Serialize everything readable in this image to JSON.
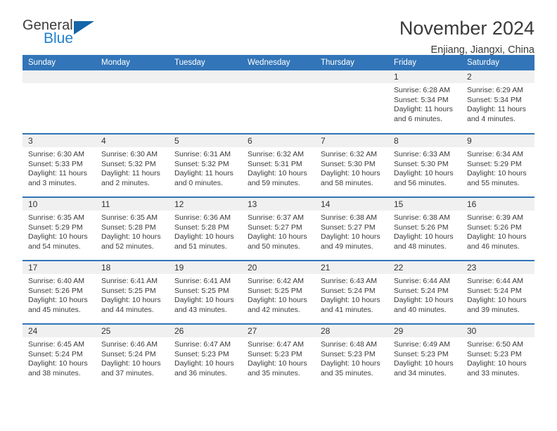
{
  "logo": {
    "word_general": "General",
    "word_blue": "Blue",
    "triangle_color": "#1565a8",
    "blue_color": "#1f7fd0"
  },
  "header": {
    "month_title": "November 2024",
    "location": "Enjiang, Jiangxi, China"
  },
  "theme": {
    "header_blue": "#3275b8",
    "daynum_band": "#f0f0f0",
    "text": "#3a3a3a"
  },
  "weekdays": [
    "Sunday",
    "Monday",
    "Tuesday",
    "Wednesday",
    "Thursday",
    "Friday",
    "Saturday"
  ],
  "weeks": [
    [
      {
        "day": ""
      },
      {
        "day": ""
      },
      {
        "day": ""
      },
      {
        "day": ""
      },
      {
        "day": ""
      },
      {
        "day": "1",
        "sunrise": "Sunrise: 6:28 AM",
        "sunset": "Sunset: 5:34 PM",
        "daylight": "Daylight: 11 hours and 6 minutes."
      },
      {
        "day": "2",
        "sunrise": "Sunrise: 6:29 AM",
        "sunset": "Sunset: 5:34 PM",
        "daylight": "Daylight: 11 hours and 4 minutes."
      }
    ],
    [
      {
        "day": "3",
        "sunrise": "Sunrise: 6:30 AM",
        "sunset": "Sunset: 5:33 PM",
        "daylight": "Daylight: 11 hours and 3 minutes."
      },
      {
        "day": "4",
        "sunrise": "Sunrise: 6:30 AM",
        "sunset": "Sunset: 5:32 PM",
        "daylight": "Daylight: 11 hours and 2 minutes."
      },
      {
        "day": "5",
        "sunrise": "Sunrise: 6:31 AM",
        "sunset": "Sunset: 5:32 PM",
        "daylight": "Daylight: 11 hours and 0 minutes."
      },
      {
        "day": "6",
        "sunrise": "Sunrise: 6:32 AM",
        "sunset": "Sunset: 5:31 PM",
        "daylight": "Daylight: 10 hours and 59 minutes."
      },
      {
        "day": "7",
        "sunrise": "Sunrise: 6:32 AM",
        "sunset": "Sunset: 5:30 PM",
        "daylight": "Daylight: 10 hours and 58 minutes."
      },
      {
        "day": "8",
        "sunrise": "Sunrise: 6:33 AM",
        "sunset": "Sunset: 5:30 PM",
        "daylight": "Daylight: 10 hours and 56 minutes."
      },
      {
        "day": "9",
        "sunrise": "Sunrise: 6:34 AM",
        "sunset": "Sunset: 5:29 PM",
        "daylight": "Daylight: 10 hours and 55 minutes."
      }
    ],
    [
      {
        "day": "10",
        "sunrise": "Sunrise: 6:35 AM",
        "sunset": "Sunset: 5:29 PM",
        "daylight": "Daylight: 10 hours and 54 minutes."
      },
      {
        "day": "11",
        "sunrise": "Sunrise: 6:35 AM",
        "sunset": "Sunset: 5:28 PM",
        "daylight": "Daylight: 10 hours and 52 minutes."
      },
      {
        "day": "12",
        "sunrise": "Sunrise: 6:36 AM",
        "sunset": "Sunset: 5:28 PM",
        "daylight": "Daylight: 10 hours and 51 minutes."
      },
      {
        "day": "13",
        "sunrise": "Sunrise: 6:37 AM",
        "sunset": "Sunset: 5:27 PM",
        "daylight": "Daylight: 10 hours and 50 minutes."
      },
      {
        "day": "14",
        "sunrise": "Sunrise: 6:38 AM",
        "sunset": "Sunset: 5:27 PM",
        "daylight": "Daylight: 10 hours and 49 minutes."
      },
      {
        "day": "15",
        "sunrise": "Sunrise: 6:38 AM",
        "sunset": "Sunset: 5:26 PM",
        "daylight": "Daylight: 10 hours and 48 minutes."
      },
      {
        "day": "16",
        "sunrise": "Sunrise: 6:39 AM",
        "sunset": "Sunset: 5:26 PM",
        "daylight": "Daylight: 10 hours and 46 minutes."
      }
    ],
    [
      {
        "day": "17",
        "sunrise": "Sunrise: 6:40 AM",
        "sunset": "Sunset: 5:26 PM",
        "daylight": "Daylight: 10 hours and 45 minutes."
      },
      {
        "day": "18",
        "sunrise": "Sunrise: 6:41 AM",
        "sunset": "Sunset: 5:25 PM",
        "daylight": "Daylight: 10 hours and 44 minutes."
      },
      {
        "day": "19",
        "sunrise": "Sunrise: 6:41 AM",
        "sunset": "Sunset: 5:25 PM",
        "daylight": "Daylight: 10 hours and 43 minutes."
      },
      {
        "day": "20",
        "sunrise": "Sunrise: 6:42 AM",
        "sunset": "Sunset: 5:25 PM",
        "daylight": "Daylight: 10 hours and 42 minutes."
      },
      {
        "day": "21",
        "sunrise": "Sunrise: 6:43 AM",
        "sunset": "Sunset: 5:24 PM",
        "daylight": "Daylight: 10 hours and 41 minutes."
      },
      {
        "day": "22",
        "sunrise": "Sunrise: 6:44 AM",
        "sunset": "Sunset: 5:24 PM",
        "daylight": "Daylight: 10 hours and 40 minutes."
      },
      {
        "day": "23",
        "sunrise": "Sunrise: 6:44 AM",
        "sunset": "Sunset: 5:24 PM",
        "daylight": "Daylight: 10 hours and 39 minutes."
      }
    ],
    [
      {
        "day": "24",
        "sunrise": "Sunrise: 6:45 AM",
        "sunset": "Sunset: 5:24 PM",
        "daylight": "Daylight: 10 hours and 38 minutes."
      },
      {
        "day": "25",
        "sunrise": "Sunrise: 6:46 AM",
        "sunset": "Sunset: 5:24 PM",
        "daylight": "Daylight: 10 hours and 37 minutes."
      },
      {
        "day": "26",
        "sunrise": "Sunrise: 6:47 AM",
        "sunset": "Sunset: 5:23 PM",
        "daylight": "Daylight: 10 hours and 36 minutes."
      },
      {
        "day": "27",
        "sunrise": "Sunrise: 6:47 AM",
        "sunset": "Sunset: 5:23 PM",
        "daylight": "Daylight: 10 hours and 35 minutes."
      },
      {
        "day": "28",
        "sunrise": "Sunrise: 6:48 AM",
        "sunset": "Sunset: 5:23 PM",
        "daylight": "Daylight: 10 hours and 35 minutes."
      },
      {
        "day": "29",
        "sunrise": "Sunrise: 6:49 AM",
        "sunset": "Sunset: 5:23 PM",
        "daylight": "Daylight: 10 hours and 34 minutes."
      },
      {
        "day": "30",
        "sunrise": "Sunrise: 6:50 AM",
        "sunset": "Sunset: 5:23 PM",
        "daylight": "Daylight: 10 hours and 33 minutes."
      }
    ]
  ]
}
